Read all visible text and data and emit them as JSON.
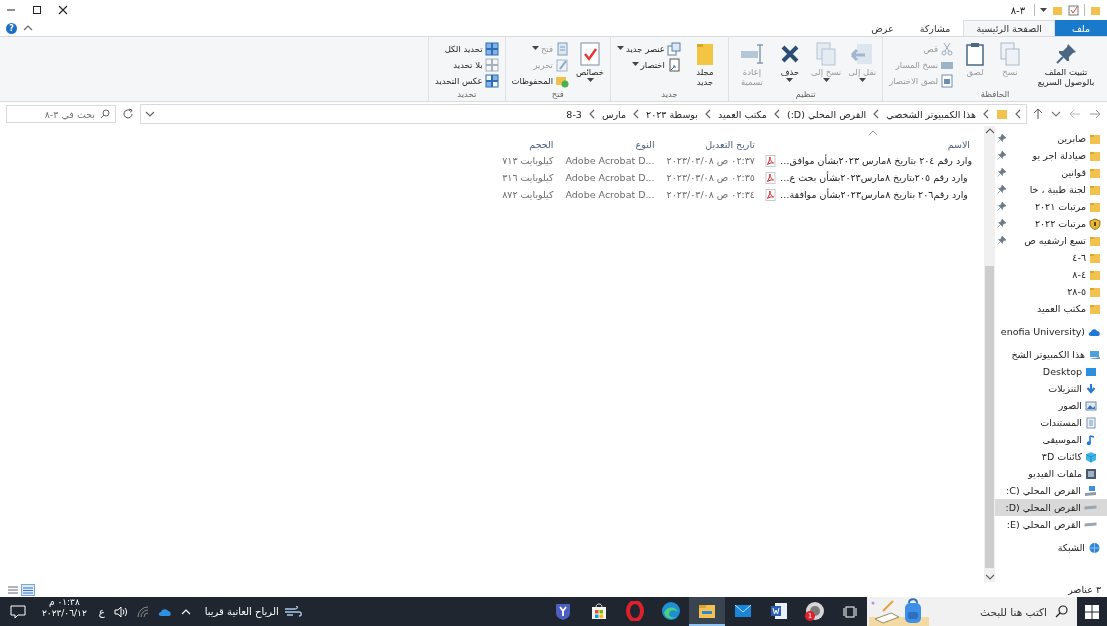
{
  "window": {
    "title": "٣-٨"
  },
  "help": "?",
  "tabs": [
    {
      "label": "ملف",
      "kind": "file",
      "selected": false
    },
    {
      "label": "الصفحة الرئيسية",
      "kind": "tab",
      "selected": true
    },
    {
      "label": "مشاركة",
      "kind": "tab",
      "selected": false
    },
    {
      "label": "عرض",
      "kind": "tab",
      "selected": false
    }
  ],
  "ribbon": {
    "groups": [
      {
        "label": "الحافظة",
        "items": [
          {
            "kind": "large",
            "label": "تثبيت الملف بالوصول السريع",
            "disabled": false,
            "dropdown": false
          },
          {
            "kind": "large",
            "label": "نسخ",
            "disabled": true,
            "dropdown": false
          },
          {
            "kind": "large",
            "label": "لصق",
            "disabled": true,
            "dropdown": false
          },
          {
            "kind": "stack",
            "buttons": [
              {
                "label": "قص",
                "disabled": true,
                "dropdown": false
              },
              {
                "label": "نسخ المسار",
                "disabled": true,
                "dropdown": false
              },
              {
                "label": "لصق الاختصار",
                "disabled": true,
                "dropdown": false
              }
            ]
          }
        ]
      },
      {
        "label": "تنظيم",
        "items": [
          {
            "kind": "large",
            "label": "نقل إلى",
            "disabled": true,
            "dropdown": true
          },
          {
            "kind": "large",
            "label": "نسخ إلى",
            "disabled": true,
            "dropdown": true
          },
          {
            "kind": "large",
            "label": "حذف",
            "disabled": false,
            "dropdown": true
          },
          {
            "kind": "large",
            "label": "إعادة تسمية",
            "disabled": true,
            "dropdown": false
          }
        ]
      },
      {
        "label": "جديد",
        "items": [
          {
            "kind": "large",
            "label": "مجلد جديد",
            "disabled": false,
            "dropdown": false
          },
          {
            "kind": "stack",
            "buttons": [
              {
                "label": "عنصر جديد",
                "disabled": false,
                "dropdown": true
              },
              {
                "label": "اختصار",
                "disabled": false,
                "dropdown": true
              }
            ]
          }
        ]
      },
      {
        "label": "فتح",
        "items": [
          {
            "kind": "large",
            "label": "خصائص",
            "disabled": false,
            "dropdown": true
          },
          {
            "kind": "stack",
            "buttons": [
              {
                "label": "فتح",
                "disabled": true,
                "dropdown": true
              },
              {
                "label": "تحرير",
                "disabled": true,
                "dropdown": false
              },
              {
                "label": "المحفوظات",
                "disabled": false,
                "dropdown": false
              }
            ]
          }
        ]
      },
      {
        "label": "تحديد",
        "items": [
          {
            "kind": "stack",
            "buttons": [
              {
                "label": "تحديد الكل",
                "disabled": false,
                "dropdown": false
              },
              {
                "label": "بلا تحديد",
                "disabled": false,
                "dropdown": false
              },
              {
                "label": "عكس التحديد",
                "disabled": false,
                "dropdown": false
              }
            ]
          }
        ]
      }
    ]
  },
  "address": {
    "breadcrumb": [
      "هذا الكمبيوتر الشخصي",
      "القرص المحلي (D:)",
      "مكتب العميد",
      "بوسطة ٢٠٢٣",
      "مارس",
      "8-3"
    ],
    "search_placeholder": "بحث في ٣-٨"
  },
  "columns": [
    {
      "label": "الاسم",
      "sorted": true
    },
    {
      "label": "تاريخ التعديل",
      "sorted": false
    },
    {
      "label": "النوع",
      "sorted": false
    },
    {
      "label": "الحجم",
      "sorted": false
    }
  ],
  "files": [
    {
      "name": "وارد رقم ٢٠٤ بتاريخ ٨مارس ٢٠٢٣بشأن موافق…",
      "modified": "٠٢:٣٧ ص ٢٠٢٣/٠٣/٠٨",
      "type": "Adobe Acrobat D...",
      "size": "كيلوبايت ٧١٣"
    },
    {
      "name": "وارد رقم ٢٠٥بتاريخ ٨مارس٢٠٢٣بشأن بحث ع…",
      "modified": "٠٢:٣٥ ص ٢٠٢٣/٠٣/٠٨",
      "type": "Adobe Acrobat D...",
      "size": "كيلوبايت ٣١٦"
    },
    {
      "name": "وارد رقم٢٠٦ بتاريخ ٨مارس٢٠٢٣بشأن موافقة…",
      "modified": "٠٢:٣٤ ص ٢٠٢٣/٠٣/٠٨",
      "type": "Adobe Acrobat D...",
      "size": "كيلوبايت ٨٧٢"
    }
  ],
  "nav": [
    {
      "label": "صابرين",
      "kind": "folder",
      "pinned": true,
      "selected": false
    },
    {
      "label": "صيادلة اجر يو",
      "kind": "folder",
      "pinned": true,
      "selected": false
    },
    {
      "label": "قوانين",
      "kind": "folder",
      "pinned": true,
      "selected": false
    },
    {
      "label": "لجنة طبية ، خا",
      "kind": "folder",
      "pinned": true,
      "selected": false
    },
    {
      "label": "مرتبات ٢٠٢١",
      "kind": "folder",
      "pinned": true,
      "selected": false
    },
    {
      "label": "مرتبات ٢٠٢٢",
      "kind": "secure",
      "pinned": true,
      "selected": false
    },
    {
      "label": "تسع ارشفيه ص",
      "kind": "folder",
      "pinned": true,
      "selected": false
    },
    {
      "label": "٦-٤",
      "kind": "folder",
      "pinned": false,
      "selected": false
    },
    {
      "label": "٤-٨",
      "kind": "folder",
      "pinned": false,
      "selected": false
    },
    {
      "label": "٥-٢٨",
      "kind": "folder",
      "pinned": false,
      "selected": false
    },
    {
      "label": "مكتب العميد",
      "kind": "folder",
      "pinned": false,
      "selected": false
    },
    {
      "label": "enofia University)",
      "kind": "cloud",
      "pinned": false,
      "selected": false
    },
    {
      "label": "هذا الكمبيوتر الشخ",
      "kind": "computer",
      "pinned": false,
      "selected": false,
      "children": [
        {
          "label": "Desktop",
          "kind": "desktop",
          "pinned": false,
          "selected": false
        },
        {
          "label": "التنزيلات",
          "kind": "downloads",
          "pinned": false,
          "selected": false
        },
        {
          "label": "الصور",
          "kind": "pictures",
          "pinned": false,
          "selected": false
        },
        {
          "label": "المستندات",
          "kind": "documents",
          "pinned": false,
          "selected": false
        },
        {
          "label": "الموسيقى",
          "kind": "music",
          "pinned": false,
          "selected": false
        },
        {
          "label": "كائنات ٣D",
          "kind": "objects",
          "pinned": false,
          "selected": false
        },
        {
          "label": "ملفات الفيديو",
          "kind": "videos",
          "pinned": false,
          "selected": false
        },
        {
          "label": "القرص المحلي (C:",
          "kind": "system-drive",
          "pinned": false,
          "selected": false
        },
        {
          "label": "القرص المحلي (D:",
          "kind": "drive",
          "pinned": false,
          "selected": true
        },
        {
          "label": "القرص المحلي (E:",
          "kind": "drive",
          "pinned": false,
          "selected": false
        }
      ]
    },
    {
      "label": "الشبكة",
      "kind": "network",
      "pinned": false,
      "selected": false
    }
  ],
  "status": "٣ عناصر",
  "taskbar": {
    "search_placeholder": "اكتب هنا للبحث",
    "apps": [
      {
        "kind": "round",
        "badge": "1",
        "active": false
      },
      {
        "kind": "document",
        "active": false
      },
      {
        "kind": "mail",
        "active": false
      },
      {
        "kind": "folder",
        "active": true
      },
      {
        "kind": "wave",
        "active": false
      },
      {
        "kind": "ring",
        "active": false
      },
      {
        "kind": "bag",
        "active": false
      },
      {
        "kind": "letter",
        "active": false
      }
    ],
    "weather": "الرياح العاتية قريبا",
    "language": "ع",
    "time": "٠١:٣٨ م",
    "date": "٢٠٢٣/٠٦/١٢"
  }
}
